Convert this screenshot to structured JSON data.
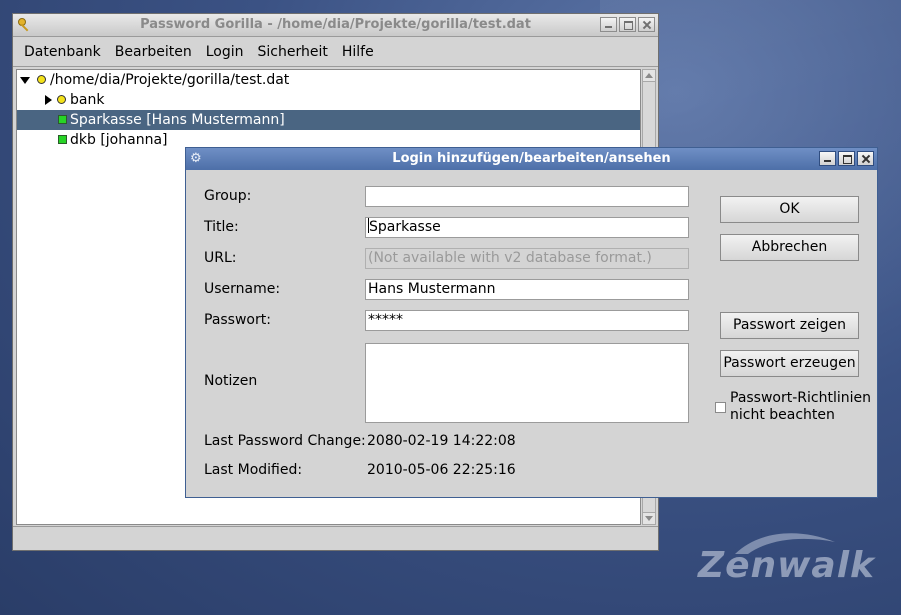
{
  "main_window": {
    "title": "Password Gorilla - /home/dia/Projekte/gorilla/test.dat",
    "menu": [
      "Datenbank",
      "Bearbeiten",
      "Login",
      "Sicherheit",
      "Hilfe"
    ],
    "tree": {
      "root": "/home/dia/Projekte/gorilla/test.dat",
      "group": "bank",
      "entries": [
        "Sparkasse [Hans Mustermann]",
        "dkb [johanna]"
      ]
    }
  },
  "dialog": {
    "title": "Login hinzufügen/bearbeiten/ansehen",
    "fields": {
      "group_label": "Group:",
      "group_value": "",
      "title_label": "Title:",
      "title_value": "Sparkasse",
      "url_label": "URL:",
      "url_value": "(Not available with v2 database format.)",
      "username_label": "Username:",
      "username_value": "Hans Mustermann",
      "password_label": "Passwort:",
      "password_value": "*****",
      "notes_label": "Notizen",
      "notes_value": "",
      "last_pw_change_label": "Last Password Change:",
      "last_pw_change_value": "2080-02-19 14:22:08",
      "last_modified_label": "Last Modified:",
      "last_modified_value": "2010-05-06 22:25:16"
    },
    "buttons": {
      "ok": "OK",
      "cancel": "Abbrechen",
      "show_password": "Passwort zeigen",
      "generate_password": "Passwort erzeugen"
    },
    "checkbox": {
      "line1": "Passwort-Richtlinien",
      "line2": "nicht beachten",
      "checked": false
    }
  },
  "desktop": {
    "logo_text": "Zenwalk"
  },
  "colors": {
    "selection": "#4a6582",
    "dialog_titlebar": "#5a7bb4",
    "desktop": "#3b5284"
  }
}
